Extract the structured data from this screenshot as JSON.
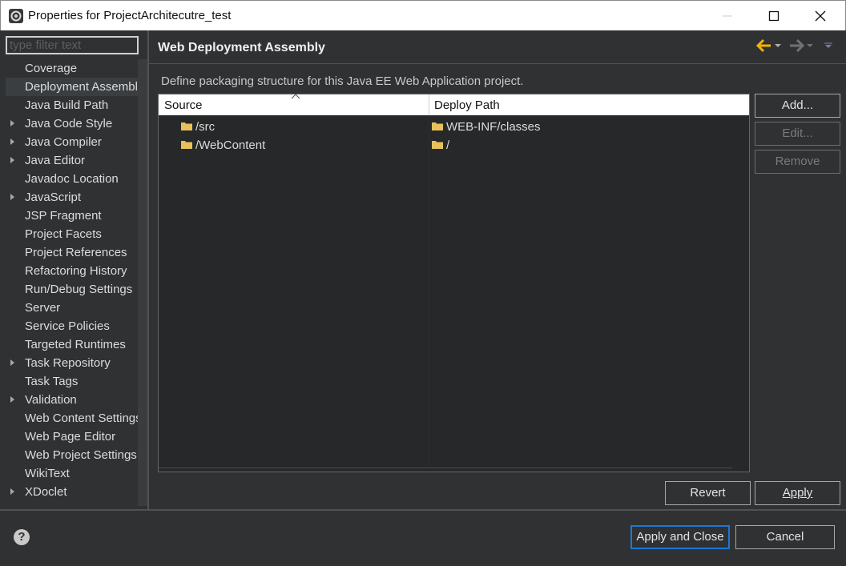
{
  "window": {
    "title": "Properties for ProjectArchitecutre_test"
  },
  "sidebar": {
    "filter_placeholder": "type filter text",
    "items": [
      {
        "label": "Coverage",
        "expandable": false,
        "selected": false
      },
      {
        "label": "Deployment Assembly",
        "expandable": false,
        "selected": true
      },
      {
        "label": "Java Build Path",
        "expandable": false,
        "selected": false
      },
      {
        "label": "Java Code Style",
        "expandable": true,
        "selected": false
      },
      {
        "label": "Java Compiler",
        "expandable": true,
        "selected": false
      },
      {
        "label": "Java Editor",
        "expandable": true,
        "selected": false
      },
      {
        "label": "Javadoc Location",
        "expandable": false,
        "selected": false
      },
      {
        "label": "JavaScript",
        "expandable": true,
        "selected": false
      },
      {
        "label": "JSP Fragment",
        "expandable": false,
        "selected": false
      },
      {
        "label": "Project Facets",
        "expandable": false,
        "selected": false
      },
      {
        "label": "Project References",
        "expandable": false,
        "selected": false
      },
      {
        "label": "Refactoring History",
        "expandable": false,
        "selected": false
      },
      {
        "label": "Run/Debug Settings",
        "expandable": false,
        "selected": false
      },
      {
        "label": "Server",
        "expandable": false,
        "selected": false
      },
      {
        "label": "Service Policies",
        "expandable": false,
        "selected": false
      },
      {
        "label": "Targeted Runtimes",
        "expandable": false,
        "selected": false
      },
      {
        "label": "Task Repository",
        "expandable": true,
        "selected": false
      },
      {
        "label": "Task Tags",
        "expandable": false,
        "selected": false
      },
      {
        "label": "Validation",
        "expandable": true,
        "selected": false
      },
      {
        "label": "Web Content Settings",
        "expandable": false,
        "selected": false
      },
      {
        "label": "Web Page Editor",
        "expandable": false,
        "selected": false
      },
      {
        "label": "Web Project Settings",
        "expandable": false,
        "selected": false
      },
      {
        "label": "WikiText",
        "expandable": false,
        "selected": false
      },
      {
        "label": "XDoclet",
        "expandable": true,
        "selected": false
      }
    ]
  },
  "page": {
    "title": "Web Deployment Assembly",
    "description": "Define packaging structure for this Java EE Web Application project.",
    "table": {
      "columns": [
        "Source",
        "Deploy Path"
      ],
      "rows": [
        {
          "source": "/src",
          "deploy_path": "WEB-INF/classes"
        },
        {
          "source": "/WebContent",
          "deploy_path": "/"
        }
      ]
    },
    "buttons": {
      "add": "Add...",
      "edit": "Edit...",
      "remove": "Remove",
      "revert": "Revert",
      "apply": "Apply"
    }
  },
  "footer": {
    "apply_and_close": "Apply and Close",
    "cancel": "Cancel"
  },
  "colors": {
    "background": "#2f3133",
    "accent_arrow": "#f0b400",
    "default_button_border": "#1e77d6",
    "folder": "#e8c15a"
  }
}
